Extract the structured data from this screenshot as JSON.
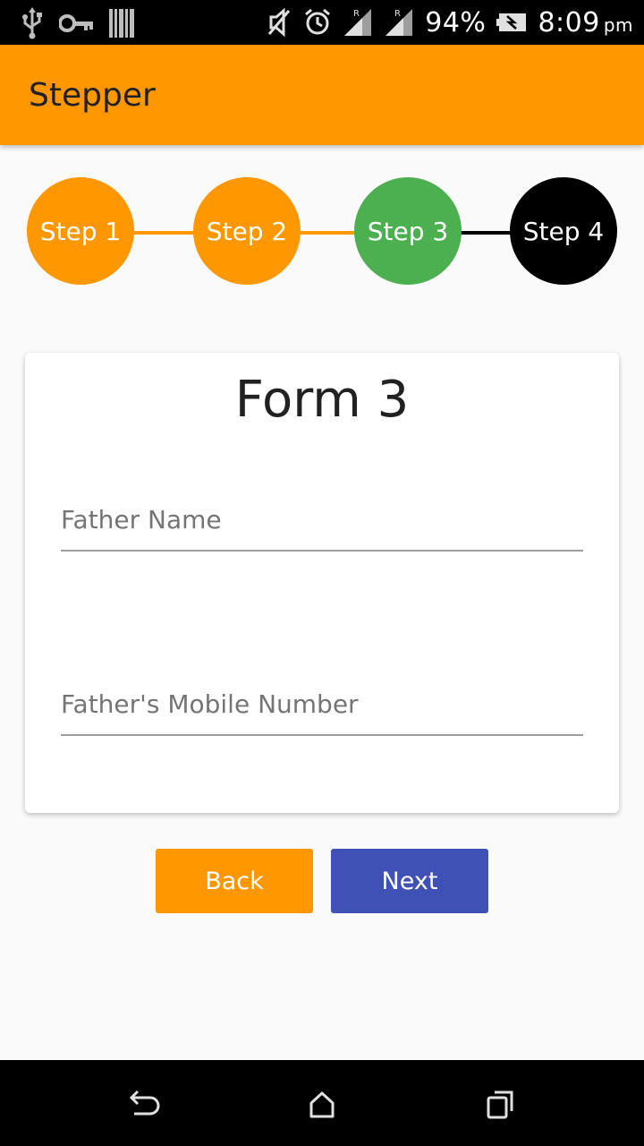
{
  "status_bar": {
    "battery": "94%",
    "time": "8:09",
    "ampm": "pm",
    "icons": [
      "usb-icon",
      "key-icon",
      "barcode-icon",
      "mute-icon",
      "alarm-icon",
      "signal-icon",
      "signal-icon",
      "battery-icon"
    ]
  },
  "app_bar": {
    "title": "Stepper",
    "color": "#ff9800"
  },
  "stepper": {
    "steps": [
      {
        "label": "Step 1",
        "color": "#ff9800"
      },
      {
        "label": "Step 2",
        "color": "#ff9800"
      },
      {
        "label": "Step 3",
        "color": "#4caf50"
      },
      {
        "label": "Step 4",
        "color": "#000000"
      }
    ],
    "connectors": [
      "#ff9800",
      "#ff9800",
      "#000000"
    ]
  },
  "form": {
    "title": "Form 3",
    "fields": [
      {
        "placeholder": "Father Name",
        "value": ""
      },
      {
        "placeholder": "Father's Mobile Number",
        "value": ""
      }
    ]
  },
  "buttons": {
    "back": {
      "label": "Back",
      "color": "#ff9800"
    },
    "next": {
      "label": "Next",
      "color": "#3f51b5"
    }
  },
  "nav_bar": {
    "icons": [
      "back-icon",
      "home-icon",
      "recents-icon"
    ]
  }
}
